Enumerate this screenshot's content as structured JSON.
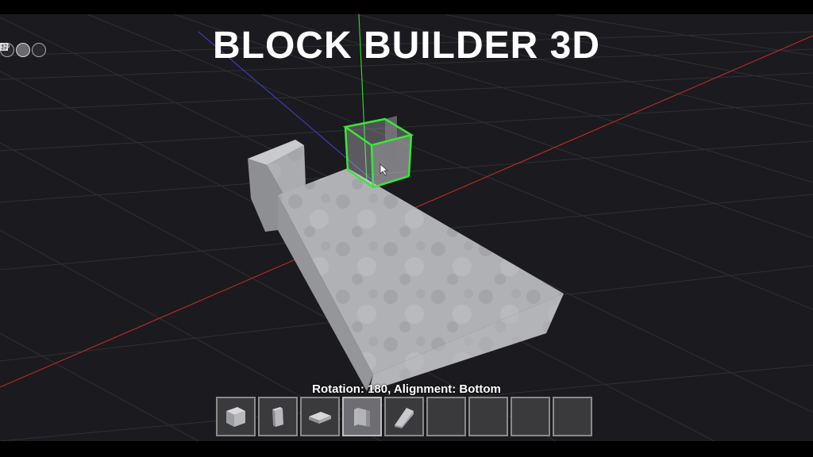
{
  "title": "BLOCK BUILDER 3D",
  "status_text": "Rotation: 180, Alignment: Bottom",
  "view_tools": [
    {
      "name": "eye-icon",
      "active": false
    },
    {
      "name": "cube-view-icon",
      "active": true
    },
    {
      "name": "grid-icon",
      "active": false
    }
  ],
  "hotbar": {
    "selected_index": 3,
    "slots": [
      {
        "item": "full-block-icon"
      },
      {
        "item": "wall-panel-icon"
      },
      {
        "item": "floor-slab-icon"
      },
      {
        "item": "corner-wall-icon"
      },
      {
        "item": "ramp-block-icon"
      },
      {
        "item": ""
      },
      {
        "item": ""
      },
      {
        "item": ""
      },
      {
        "item": ""
      }
    ]
  },
  "colors": {
    "background": "#1b1a1e",
    "grid": "#2f2f35",
    "x_axis": "#b42a2a",
    "y_axis": "#2fd02f",
    "z_axis": "#3b3bb8",
    "selection": "#37e837",
    "concrete": "#a9aaae"
  }
}
